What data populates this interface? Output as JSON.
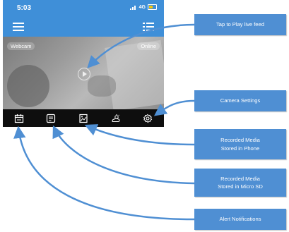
{
  "status_bar": {
    "time": "5:03",
    "network": "4G"
  },
  "feed": {
    "camera_name": "Webcam",
    "status": "Online"
  },
  "tabs": [
    {
      "name": "calendar-icon",
      "label": "Alert Notifications"
    },
    {
      "name": "note-icon",
      "label": "Recorded Media Stored in Micro SD"
    },
    {
      "name": "image-icon",
      "label": "Recorded Media Stored in Phone"
    },
    {
      "name": "weather-icon",
      "label": ""
    },
    {
      "name": "gear-icon",
      "label": "Camera Settings"
    }
  ],
  "callouts": {
    "play": "Tap to Play live feed",
    "settings": "Camera Settings",
    "phone_media_l1": "Recorded Media",
    "phone_media_l2": "Stored in Phone",
    "sd_media_l1": "Recorded Media",
    "sd_media_l2": "Stored in Micro SD",
    "alerts": "Alert Notifications"
  },
  "colors": {
    "accent": "#3f8fd8",
    "callout": "#4f8fd3",
    "tabbar": "#0e0e0e"
  }
}
